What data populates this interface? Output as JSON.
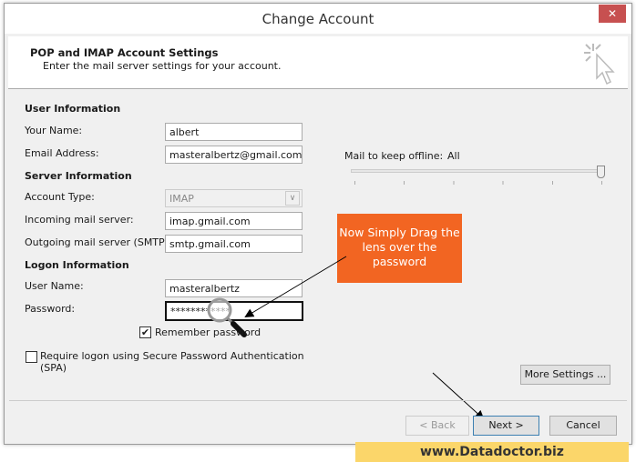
{
  "window": {
    "title": "Change Account",
    "close": "✕"
  },
  "header": {
    "title": "POP and IMAP Account Settings",
    "subtitle": "Enter the mail server settings for your account."
  },
  "user_info": {
    "heading": "User Information",
    "name_label": "Your Name:",
    "name": "albert",
    "email_label": "Email Address:",
    "email": "masteralbertz@gmail.com"
  },
  "server_info": {
    "heading": "Server Information",
    "type_label": "Account Type:",
    "type": "IMAP",
    "incoming_label": "Incoming mail server:",
    "incoming": "imap.gmail.com",
    "outgoing_label": "Outgoing mail server (SMTP):",
    "outgoing": "smtp.gmail.com"
  },
  "logon_info": {
    "heading": "Logon Information",
    "user_label": "User Name:",
    "user": "masteralbertz",
    "password_label": "Password:",
    "password": "************",
    "remember": "Remember password",
    "remember_checked": true,
    "spa": "Require logon using Secure Password Authentication (SPA)",
    "spa_checked": false
  },
  "offline": {
    "label": "Mail to keep offline:",
    "value": "All",
    "slider_fraction": 1.0
  },
  "buttons": {
    "more": "More Settings ...",
    "back": "< Back",
    "next": "Next >",
    "cancel": "Cancel"
  },
  "callout": {
    "text": "Now Simply Drag the lens over the password"
  },
  "watermark": "www.Datadoctor.biz"
}
